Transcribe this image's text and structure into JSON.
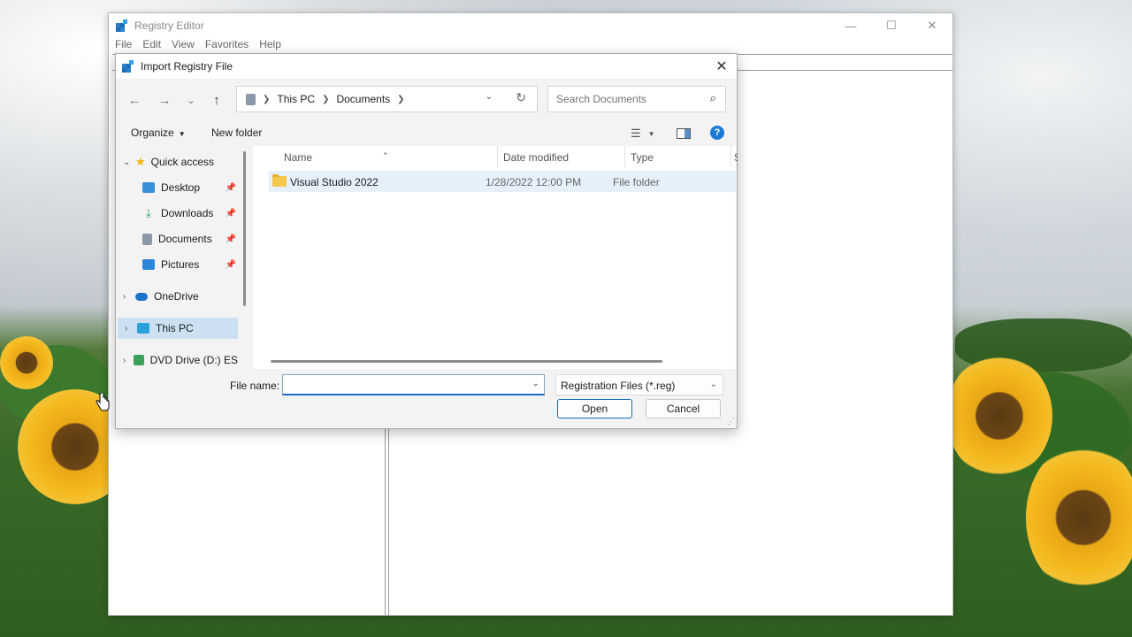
{
  "registry_editor": {
    "title": "Registry Editor",
    "menu": [
      "File",
      "Edit",
      "View",
      "Favorites",
      "Help"
    ],
    "controls": {
      "minimize": "—",
      "maximize": "☐",
      "close": "✕"
    }
  },
  "dialog": {
    "title": "Import Registry File",
    "close": "✕",
    "nav": {
      "back": "←",
      "forward": "→",
      "recent": "⌄",
      "up": "↑"
    },
    "breadcrumb": [
      "This PC",
      "Documents"
    ],
    "search_placeholder": "Search Documents",
    "commands": {
      "organize": "Organize",
      "new_folder": "New folder"
    },
    "help": "?",
    "nav_pane": [
      {
        "label": "Quick access",
        "expander": "⌄",
        "icon": "star-icon",
        "color": "#f2b400"
      },
      {
        "label": "Desktop",
        "icon": "desktop-icon",
        "color": "#3a8fd6",
        "pinned": true
      },
      {
        "label": "Downloads",
        "icon": "download-icon",
        "color": "#1ea05c",
        "pinned": true
      },
      {
        "label": "Documents",
        "icon": "document-icon",
        "color": "#8a99a8",
        "pinned": true
      },
      {
        "label": "Pictures",
        "icon": "picture-icon",
        "color": "#2d86d8",
        "pinned": true
      },
      {
        "label": "OneDrive",
        "expander": "›",
        "icon": "cloud-icon",
        "color": "#1a73c9"
      },
      {
        "label": "This PC",
        "expander": "›",
        "icon": "computer-icon",
        "color": "#2aa1d8",
        "selected": true
      },
      {
        "label": "DVD Drive (D:) ES",
        "expander": "›",
        "icon": "disc-drive-icon",
        "color": "#3aa05a"
      }
    ],
    "columns": {
      "name": "Name",
      "date": "Date modified",
      "type": "Type",
      "size": "S"
    },
    "files": [
      {
        "name": "Visual Studio 2022",
        "date": "1/28/2022 12:00 PM",
        "type": "File folder"
      }
    ],
    "file_name_label": "File name:",
    "file_name_value": "",
    "filter": "Registration Files (*.reg)",
    "buttons": {
      "open": "Open",
      "cancel": "Cancel"
    }
  }
}
